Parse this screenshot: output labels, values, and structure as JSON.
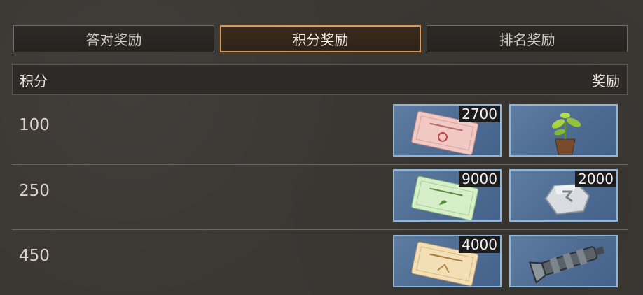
{
  "tabs": [
    {
      "label": "答对奖励",
      "active": false
    },
    {
      "label": "积分奖励",
      "active": true
    },
    {
      "label": "排名奖励",
      "active": false
    }
  ],
  "table": {
    "col_score": "积分",
    "col_reward": "奖励"
  },
  "rows": [
    {
      "score": "100",
      "items": [
        {
          "icon": "red-ticket-icon",
          "qty": "2700"
        },
        {
          "icon": "potted-plant-icon",
          "qty": ""
        }
      ]
    },
    {
      "score": "250",
      "items": [
        {
          "icon": "green-ticket-icon",
          "qty": "9000"
        },
        {
          "icon": "silver-stone-icon",
          "qty": "2000"
        }
      ]
    },
    {
      "score": "450",
      "items": [
        {
          "icon": "gold-ticket-icon",
          "qty": "4000"
        },
        {
          "icon": "mechanical-part-icon",
          "qty": ""
        }
      ]
    }
  ],
  "colors": {
    "accent": "#d99a55",
    "item_border": "#8fb6d9",
    "item_bg": "#4f6d93"
  }
}
